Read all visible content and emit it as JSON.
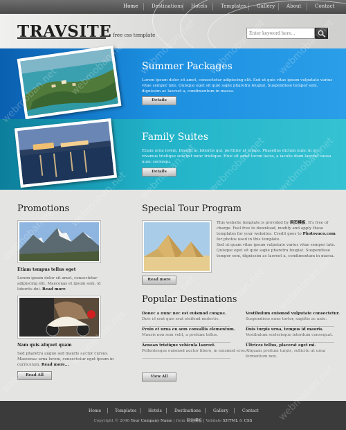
{
  "nav": {
    "items": [
      "Home",
      "Destinations",
      "Hotels",
      "Templates",
      "Gallery",
      "About",
      "Contact"
    ]
  },
  "header": {
    "logo": "TRAVSITE",
    "tagline": "free css template",
    "search_placeholder": "Enter keyword here..."
  },
  "banner1": {
    "title": "Summer Packages",
    "text": "Lorem ipsum dolor sit amet, consectetur adipiscing elit. Sed ut quis vitae ipsum vulputate varius vitae semper tate. Quisque eget sit quie sapie pharetra feugiat. Suspendisse tempor sem, dignissim ac laoreet a, condimentum in massa.",
    "button": "Details"
  },
  "banner2": {
    "title": "Family Suites",
    "text": "Etiam urna lorem, blandit ac lobortis qui, porttitor at tempo. Phasellus dictum nunc in orci vivamus tristique suscipit nunc tristique. Huic sit amet lorem lacus, a iaculis diam laoreet causa nunc sociosqu.",
    "button": "Details"
  },
  "promotions": {
    "title": "Promotions",
    "items": [
      {
        "caption": "Etiam tempus tellus eget",
        "text": "Lorem ipsum dolor sit amet, consectetur adipiscing elit. Maecenas et ipsum sem, id lobortis dui.",
        "more": "Read more"
      },
      {
        "caption": "Nam quis aliquet quam",
        "text": "Sed pharetra augue sed mauris auctor cursus. Maecenas urna lorem, consectetur eget ipsum in curriculum.",
        "more": "Read more..."
      }
    ],
    "button": "Read All"
  },
  "tour": {
    "title": "Special Tour Program",
    "p1_a": "This website template is provided by ",
    "p1_brand": "网页模板",
    "p1_b": ". It's free of charge. Feel free to download, modify and apply these templates for your websites. Credit goes to ",
    "p1_link": "Photovaco.com",
    "p1_c": " for photos used in this template.",
    "p2": "Sed ut quam vitae ipsum vulputate varius vitae semper tate. Quisque eget sit quie sapie pharetra feugiat. Suspendisse tempor sem, dignissim ac laoreet a, condimentum in massa.",
    "button": "Read more"
  },
  "destinations": {
    "title": "Popular Destinations",
    "left": [
      {
        "title": "Donec a nunc nec est euismod congue.",
        "desc": "Duis id erat quis erat eleifend molestie."
      },
      {
        "title": "Proin et urna eu sem convallis elementum.",
        "desc": "Mauris non sem velit, a pretium tellus."
      },
      {
        "title": "Aenean tristique vehicula laoreet.",
        "desc": "Pellentesque euismod auctor libero, in euismod eros."
      }
    ],
    "right": [
      {
        "title": "Vestibulum euismod vulputate consectetur.",
        "desc": "Suspendisse nunc tortor, sagittis ac ante."
      },
      {
        "title": "Duis turpis urna, tempus id mauris.",
        "desc": "Vestibulum scelerisque interdum consequat."
      },
      {
        "title": "Ultrices tellus, placerat eget mi.",
        "desc": "Aliquam pretium turpis, sollicitu ut urna fermentum non."
      }
    ],
    "button": "View All"
  },
  "footer": {
    "links": [
      "Home",
      "Templates",
      "Hotels",
      "Destinations",
      "Gallery",
      "Contact"
    ],
    "copy_a": "Copyright © 2048 ",
    "company": "Your Company Name",
    "copy_b": " | from ",
    "brand": "网站模板",
    "copy_c": " | Validate ",
    "xhtml": "XHTML",
    "copy_d": " & ",
    "css": "CSS"
  },
  "watermark": "webmoban.net"
}
